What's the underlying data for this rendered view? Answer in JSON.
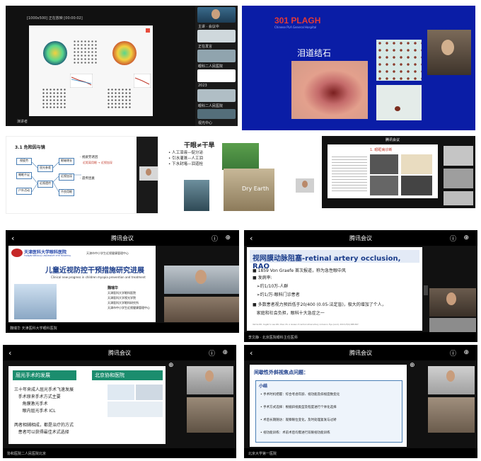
{
  "p1": {
    "toolbar": "[1000x500] 正在放映 [00:00:02]",
    "sidebar_labels": [
      "主讲 · 会议中",
      "正在发言",
      "眼科二人民医院",
      "2023",
      "眼科二人民医院",
      "视光中心"
    ],
    "bottom": "演讲者"
  },
  "p2": {
    "logo": "301 PLAGH",
    "logo_sub": "Chinese PLA General Hospital",
    "caption": "泪道结石"
  },
  "p3": {
    "title": "3.1 危险因与镜",
    "boxes": [
      "视疲劳",
      "睡眠不足",
      "户外活动",
      "屈光参差",
      "近视遗传",
      "眼轴增长",
      "近视加深",
      "不良用眼"
    ],
    "notes": [
      "· 视疲劳诱因",
      "· 遗传因素"
    ],
    "text": "近距离用眼 → 近视加深"
  },
  "p4": {
    "title": "干眼≠干旱",
    "bullets": [
      "• 人工泪液—促分泌",
      "• 引水灌溉—人工泪",
      "• 下水封堵—泪道栓"
    ],
    "photo_caption": "Dry Earth"
  },
  "p5": {
    "title": "1. 眼眶病诊断",
    "header": "腾讯会议"
  },
  "p6": {
    "header": "腾讯会议",
    "uni_name": "天津医科大学眼科医院",
    "uni_name_en": "TIANJIN MEDICAL UNIVERSITY EYE HOSPITAL",
    "center": "天津市中小学生近视健康管理中心",
    "title": "儿童近视防控干预措施研究进展",
    "subtitle": "Clinical new progress in children myopia prevention and treatment",
    "speaker": "魏瑞华",
    "affil": [
      "天津医科大学眼科医院",
      "天津医科大学视光学院",
      "天津医科大学眼科研究所",
      "天津市中小学生近视健康管理中心"
    ],
    "bottom": "魏瑞华 天津医科大学眼科医院"
  },
  "p7": {
    "header": "腾讯会议",
    "title": "视网膜动脉阻塞-retinal artery occlusion, RAO",
    "lines": [
      "■ 1859 Von Graefe 首次报道，称为急性眼中风",
      "■ 发病率:",
      "   ➢约1/10万-人群",
      "   ➢约1/万-眼科门诊患者",
      "■ 多数患者视力预后低于20/400 (0.05-法定盲)，极大的增加了个人，",
      "   家庭和社会负担，眼科十大急症之一"
    ],
    "footnote": "Varma DD, Cugati S, Lee AW, Chen CS. A review of central retinal artery occlusion. Eye (Lond). 2013;27(6):688-697.",
    "bottom": "李文静 · 北京医院眼科主任医师"
  },
  "p8": {
    "header": "腾讯会议",
    "title": "屈光手术的发展",
    "hospital": "北京协和医院",
    "items": [
      "三十年来成人屈光手术飞速发展",
      "   手术原来手术方式主要",
      "      角膜激光手术",
      "      眼内屈光手术 ICL",
      "两者相辅相成，都是治疗的方式",
      "   患者可以获得最佳术式选择"
    ],
    "bottom": "协和医院二人民医院北京"
  },
  "p9": {
    "header": "腾讯会议",
    "title": "间歇性外斜视焦点问题：",
    "box_title": "小结",
    "items": [
      "• 手术时机把握：综合考虑年龄、视功能及斜视度数变化",
      "• 手术方式选择：根据斜视类型及程度进行个体化选择",
      "• 术后长期随访：观察眼位变化，及时处理复发与过矫",
      "• 视功能训练：术前术后均需进行双眼视功能训练"
    ],
    "bottom": "北京大学第一医院"
  }
}
